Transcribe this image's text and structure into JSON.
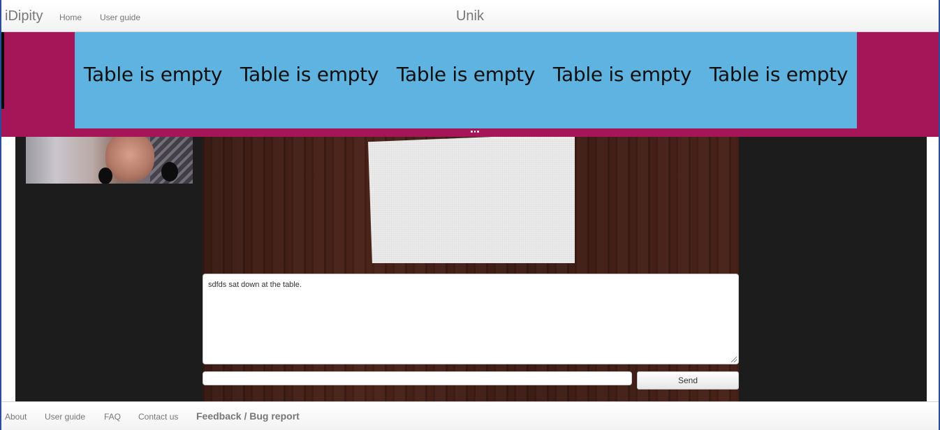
{
  "header": {
    "brand": "iDipity",
    "nav": {
      "home": "Home",
      "user_guide": "User guide"
    },
    "page_title": "Unik"
  },
  "tables": [
    {
      "status": "Table is empty"
    },
    {
      "status": "Table is empty"
    },
    {
      "status": "Table is empty"
    },
    {
      "status": "Table is empty"
    },
    {
      "status": "Table is empty"
    }
  ],
  "chat": {
    "log_text": "sdfds sat down at the table.",
    "input_value": "",
    "send_label": "Send"
  },
  "footer": {
    "about": "About",
    "user_guide": "User guide",
    "faq": "FAQ",
    "contact": "Contact us",
    "feedback": "Feedback / Bug report"
  },
  "colors": {
    "banner": "#a41658",
    "tables_panel": "#5fb3e0",
    "main_background": "#1c1c1c"
  },
  "icons": {
    "collapse_handle": "dots-handle-icon"
  }
}
